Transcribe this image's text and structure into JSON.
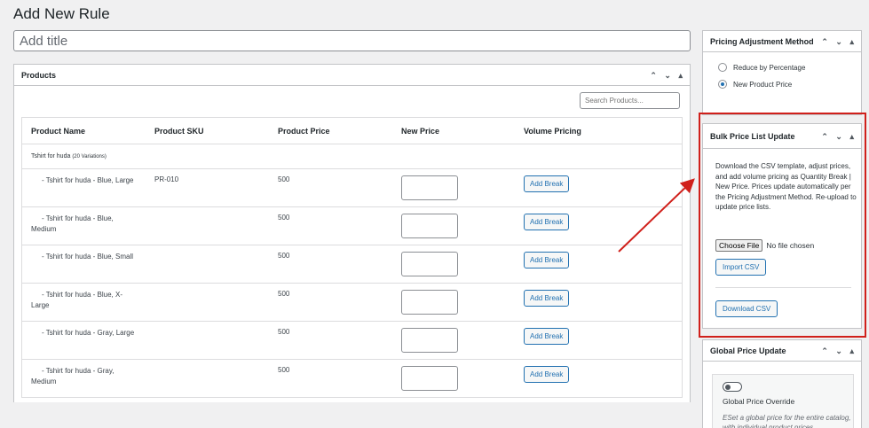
{
  "page": {
    "title": "Add New Rule",
    "title_placeholder": "Add title"
  },
  "products": {
    "header": "Products",
    "search_placeholder": "Search Products...",
    "columns": [
      "Product Name",
      "Product SKU",
      "Product Price",
      "New Price",
      "Volume Pricing"
    ],
    "group": {
      "name": "Tshirt for huda",
      "count": "(20 Variations)"
    },
    "rows": [
      {
        "name": "- Tshirt for huda - Blue, Large",
        "sku": "PR-010",
        "price": "500",
        "action": "Add Break"
      },
      {
        "name": "- Tshirt for huda - Blue, Medium",
        "sku": "",
        "price": "500",
        "action": "Add Break"
      },
      {
        "name": "- Tshirt for huda - Blue, Small",
        "sku": "",
        "price": "500",
        "action": "Add Break"
      },
      {
        "name": "- Tshirt for huda - Blue, X-Large",
        "sku": "",
        "price": "500",
        "action": "Add Break"
      },
      {
        "name": "- Tshirt for huda - Gray, Large",
        "sku": "",
        "price": "500",
        "action": "Add Break"
      },
      {
        "name": "- Tshirt for huda - Gray, Medium",
        "sku": "",
        "price": "500",
        "action": "Add Break"
      }
    ]
  },
  "pricing_method": {
    "header": "Pricing Adjustment Method",
    "options": [
      {
        "label": "Reduce by Percentage",
        "selected": false
      },
      {
        "label": "New Product Price",
        "selected": true
      }
    ]
  },
  "bulk": {
    "header": "Bulk Price List Update",
    "description": "Download the CSV template, adjust prices, and add volume pricing as Quantity Break | New Price. Prices update automatically per the Pricing Adjustment Method. Re-upload to update price lists.",
    "choose_file": "Choose File",
    "no_file": "No file chosen",
    "import": "Import CSV",
    "download": "Download CSV"
  },
  "global": {
    "header": "Global Price Update",
    "override_label": "Global Price Override",
    "desc": "ESet a global price for the entire catalog, with individual product prices"
  },
  "colors": {
    "accent": "#2271b1",
    "highlight": "#d0201b"
  }
}
